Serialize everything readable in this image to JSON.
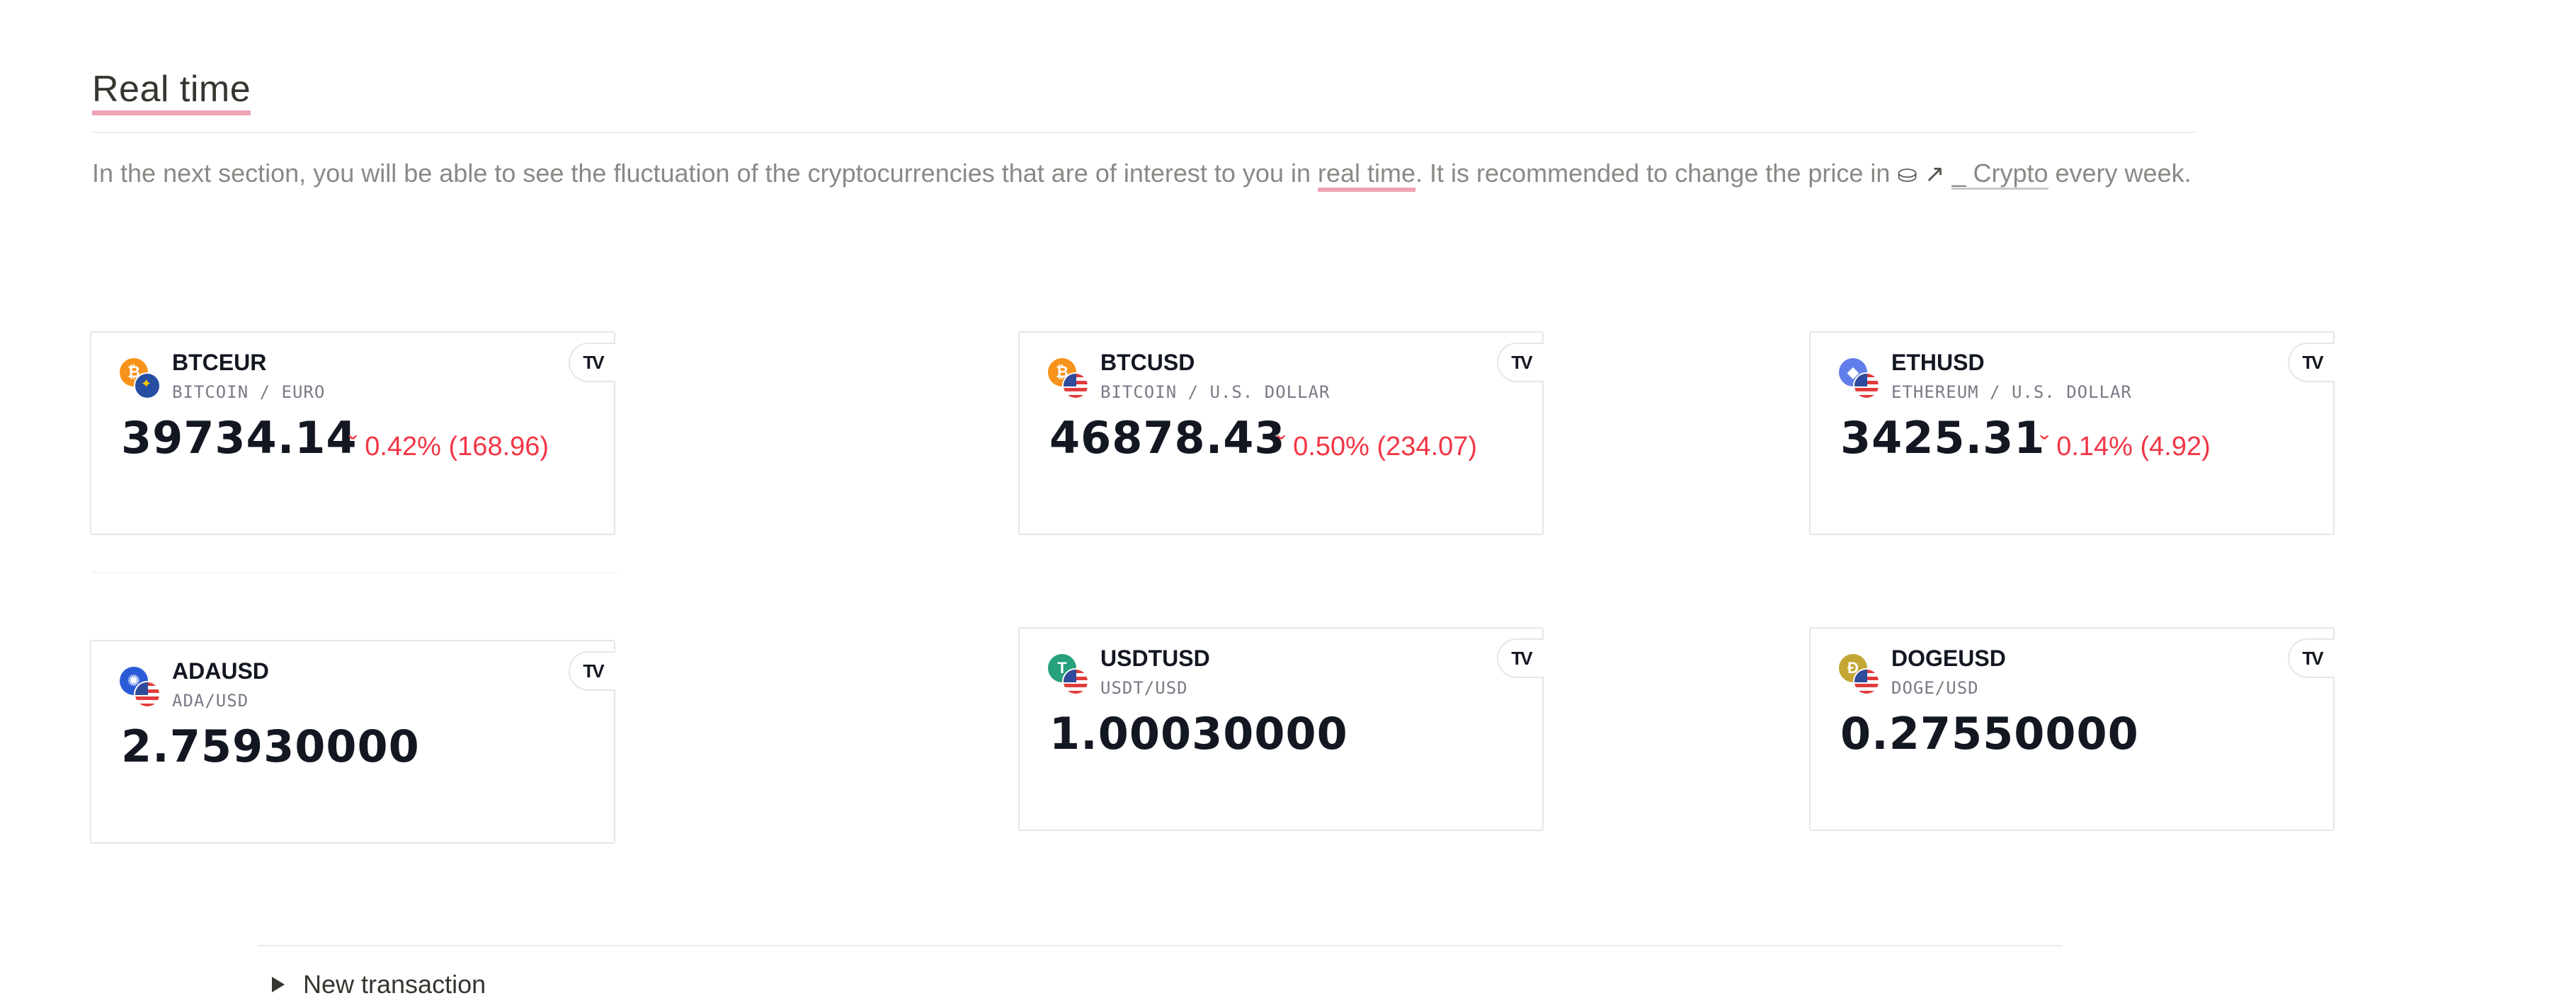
{
  "section": {
    "title": "Real time",
    "paragraph_part1": "In the next section, you will be able to see the fluctuation of the cryptocurrencies that are of interest to you in ",
    "paragraph_highlight": "real time",
    "paragraph_part2": ". It is recommended to change the price in ",
    "paragraph_link": "_ Crypto",
    "paragraph_part3": " every week."
  },
  "cards": [
    {
      "symbol": "BTCEUR",
      "description": "BITCOIN / EURO",
      "price": "39734.14",
      "change": "0.42% (168.96)",
      "coin_icon": "bitcoin-icon",
      "flag_icon": "eu-flag-icon",
      "coin_color": "#f7931a",
      "coin_glyph": "₿"
    },
    {
      "symbol": "BTCUSD",
      "description": "BITCOIN / U.S. DOLLAR",
      "price": "46878.43",
      "change": "0.50% (234.07)",
      "coin_icon": "bitcoin-icon",
      "flag_icon": "us-flag-icon",
      "coin_color": "#f7931a",
      "coin_glyph": "₿"
    },
    {
      "symbol": "ETHUSD",
      "description": "ETHEREUM / U.S. DOLLAR",
      "price": "3425.31",
      "change": "0.14% (4.92)",
      "coin_icon": "ethereum-icon",
      "flag_icon": "us-flag-icon",
      "coin_color": "#627eea",
      "coin_glyph": "◆"
    },
    {
      "symbol": "ADAUSD",
      "description": "ADA/USD",
      "price": "2.75930000",
      "change": "",
      "coin_icon": "cardano-icon",
      "flag_icon": "us-flag-icon",
      "coin_color": "#2a5bd7",
      "coin_glyph": "✺"
    },
    {
      "symbol": "USDTUSD",
      "description": "USDT/USD",
      "price": "1.00030000",
      "change": "",
      "coin_icon": "tether-icon",
      "flag_icon": "us-flag-icon",
      "coin_color": "#26a17b",
      "coin_glyph": "T"
    },
    {
      "symbol": "DOGEUSD",
      "description": "DOGE/USD",
      "price": "0.27550000",
      "change": "",
      "coin_icon": "dogecoin-icon",
      "flag_icon": "us-flag-icon",
      "coin_color": "#c3a634",
      "coin_glyph": "Đ"
    }
  ],
  "tradingview_button": "TV",
  "toggle": {
    "label": "New transaction"
  },
  "colors": {
    "accent_underline": "#f0a3b6",
    "negative": "#f23645"
  }
}
